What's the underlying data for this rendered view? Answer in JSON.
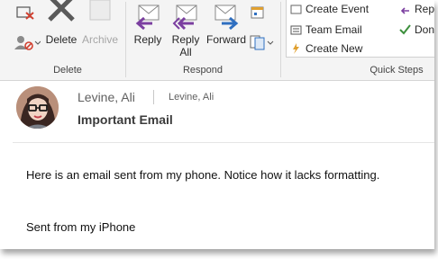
{
  "ribbon": {
    "delete_group": {
      "label": "Delete",
      "delete_button": "Delete",
      "archive_button": "Archive"
    },
    "respond_group": {
      "label": "Respond",
      "reply_button": "Reply",
      "reply_all_line1": "Reply",
      "reply_all_line2": "All",
      "forward_button": "Forward"
    },
    "quick_steps_group": {
      "label": "Quick Steps",
      "items": [
        "Create Event",
        "Team Email",
        "Create New",
        "Reply",
        "Done"
      ]
    }
  },
  "email": {
    "sender": "Levine, Ali",
    "recipient": "Levine, Ali",
    "subject": "Important Email",
    "body_lines": [
      "Here is an email sent from my phone. Notice how it lacks formatting.",
      "Sent from my iPhone"
    ]
  },
  "colors": {
    "ribbon_bg": "#f4f4f4",
    "reply_arrow_purple": "#7b3fa0",
    "forward_arrow_blue": "#2f6fc0",
    "done_check_green": "#3c8f3c"
  },
  "icons": [
    "ignore-icon",
    "junk-icon",
    "delete-x-icon",
    "archive-icon",
    "reply-icon",
    "reply-all-icon",
    "forward-icon",
    "meeting-icon",
    "more-respond-icon",
    "team-email-icon",
    "create-new-icon",
    "done-check-icon"
  ]
}
